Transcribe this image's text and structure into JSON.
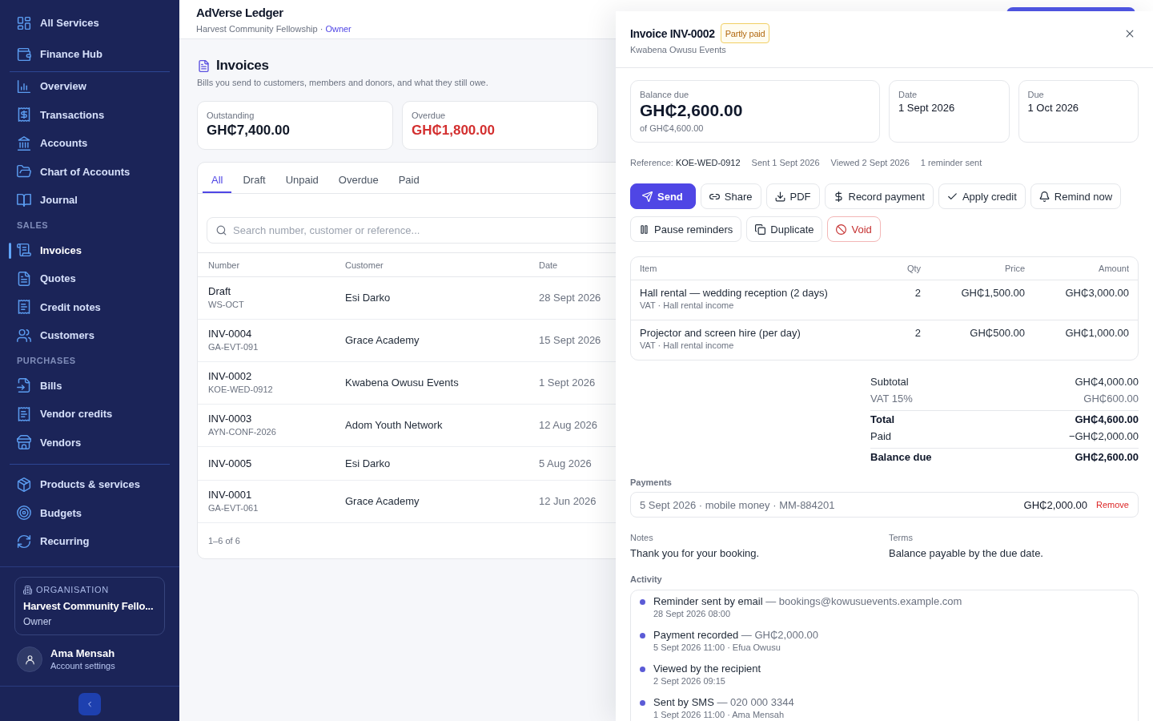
{
  "sidebar": {
    "groups": [
      {
        "items": [
          {
            "label": "All Services",
            "selected": false
          },
          {
            "label": "Finance Hub",
            "selected": false
          }
        ]
      },
      {
        "items": [
          {
            "label": "Overview",
            "selected": false
          },
          {
            "label": "Transactions",
            "selected": false
          },
          {
            "label": "Accounts",
            "selected": false
          },
          {
            "label": "Chart of Accounts",
            "selected": false
          },
          {
            "label": "Journal",
            "selected": false
          }
        ]
      },
      {
        "heading": "SALES",
        "items": [
          {
            "label": "Invoices",
            "selected": true
          },
          {
            "label": "Quotes",
            "selected": false
          },
          {
            "label": "Credit notes",
            "selected": false
          },
          {
            "label": "Customers",
            "selected": false
          }
        ]
      },
      {
        "heading": "PURCHASES",
        "items": [
          {
            "label": "Bills",
            "selected": false
          },
          {
            "label": "Vendor credits",
            "selected": false
          },
          {
            "label": "Vendors",
            "selected": false
          }
        ]
      },
      {
        "items": [
          {
            "label": "Products & services",
            "selected": false
          },
          {
            "label": "Budgets",
            "selected": false
          },
          {
            "label": "Recurring",
            "selected": false
          }
        ]
      }
    ],
    "organisation": {
      "label": "ORGANISATION",
      "name": "Harvest Community Fello...",
      "role": "Owner"
    },
    "user": {
      "name": "Ama Mensah",
      "link": "Account settings"
    }
  },
  "header": {
    "title": "AdVerse Ledger",
    "organisation": "Harvest Community Fellowship ·",
    "role": "Owner"
  },
  "page": {
    "title": "Invoices",
    "description": "Bills you send to customers, members and donors, and what they still owe."
  },
  "stats": [
    {
      "label": "Outstanding",
      "value": "GH₵7,400.00",
      "color": "#111827"
    },
    {
      "label": "Overdue",
      "value": "GH₵1,800.00",
      "color": "#d32f2f"
    }
  ],
  "tabs": [
    {
      "label": "All",
      "selected": true
    },
    {
      "label": "Draft",
      "selected": false
    },
    {
      "label": "Unpaid",
      "selected": false
    },
    {
      "label": "Overdue",
      "selected": false
    },
    {
      "label": "Paid",
      "selected": false
    }
  ],
  "search": {
    "placeholder": "Search number, customer or reference..."
  },
  "table": {
    "columns": [
      "Number",
      "Customer",
      "Date"
    ],
    "rows": [
      {
        "number": "Draft",
        "reference": "WS-OCT",
        "customer": "Esi Darko",
        "date": "28 Sept 2026"
      },
      {
        "number": "INV-0004",
        "reference": "GA-EVT-091",
        "customer": "Grace Academy",
        "date": "15 Sept 2026"
      },
      {
        "number": "INV-0002",
        "reference": "KOE-WED-0912",
        "customer": "Kwabena Owusu Events",
        "date": "1 Sept 2026"
      },
      {
        "number": "INV-0003",
        "reference": "AYN-CONF-2026",
        "customer": "Adom Youth Network",
        "date": "12 Aug 2026"
      },
      {
        "number": "INV-0005",
        "customer": "Esi Darko",
        "date": "5 Aug 2026"
      },
      {
        "number": "INV-0001",
        "reference": "GA-EVT-061",
        "customer": "Grace Academy",
        "date": "12 Jun 2026"
      }
    ],
    "footer": "1–6 of 6"
  },
  "drawer": {
    "title": "Invoice INV-0002",
    "status": "Partly paid",
    "customer": "Kwabena Owusu Events",
    "summary": [
      {
        "kind": "balance",
        "label": "Balance due",
        "value": "GH₵2,600.00",
        "note": "of GH₵4,600.00"
      },
      {
        "kind": "date",
        "label": "Date",
        "value": "1 Sept 2026"
      },
      {
        "kind": "date",
        "label": "Due",
        "value": "1 Oct 2026"
      }
    ],
    "reference": {
      "label": "Reference:",
      "value": "KOE-WED-0912"
    },
    "meta": [
      "Sent 1 Sept 2026",
      "Viewed 2 Sept 2026",
      "1 reminder sent"
    ],
    "actions": [
      {
        "label": "Send",
        "kind": "primary"
      },
      {
        "label": "Share",
        "kind": "default"
      },
      {
        "label": "PDF",
        "kind": "default"
      },
      {
        "label": "Record payment",
        "kind": "default"
      },
      {
        "label": "Apply credit",
        "kind": "default"
      },
      {
        "label": "Remind now",
        "kind": "default"
      },
      {
        "label": "Pause reminders",
        "kind": "default"
      },
      {
        "label": "Duplicate",
        "kind": "default"
      },
      {
        "label": "Void",
        "kind": "danger"
      }
    ],
    "line_items": {
      "columns": [
        "Item",
        "Qty",
        "Price",
        "Amount"
      ],
      "rows": [
        {
          "name": "Hall rental — wedding reception (2 days)",
          "detail": "VAT · Hall rental income",
          "qty": "2",
          "price": "GH₵1,500.00",
          "amount": "GH₵3,000.00"
        },
        {
          "name": "Projector and screen hire (per day)",
          "detail": "VAT · Hall rental income",
          "qty": "2",
          "price": "GH₵500.00",
          "amount": "GH₵1,000.00"
        }
      ]
    },
    "totals": [
      {
        "label": "Subtotal",
        "value": "GH₵4,000.00",
        "kind": "normal"
      },
      {
        "label": "VAT 15%",
        "value": "GH₵600.00",
        "kind": "muted"
      },
      {
        "label": "Total",
        "value": "GH₵4,600.00",
        "kind": "strong"
      },
      {
        "label": "Paid",
        "value": "−GH₵2,000.00",
        "kind": "normal"
      },
      {
        "label": "Balance due",
        "value": "GH₵2,600.00",
        "kind": "strong"
      }
    ],
    "payments": {
      "label": "Payments",
      "rows": [
        {
          "description": "5 Sept 2026 · mobile money · MM-884201",
          "amount": "GH₵2,000.00",
          "action": "Remove"
        }
      ]
    },
    "notes": {
      "label": "Notes",
      "text": "Thank you for your booking."
    },
    "terms": {
      "label": "Terms",
      "text": "Balance payable by the due date."
    },
    "activity": {
      "label": "Activity",
      "entries": [
        {
          "title": "Reminder sent by email",
          "detail": "— bookings@kowusuevents.example.com",
          "time": "28 Sept 2026 08:00"
        },
        {
          "title": "Payment recorded",
          "detail": "— GH₵2,000.00",
          "time": "5 Sept 2026 11:00 · Efua Owusu"
        },
        {
          "title": "Viewed by the recipient",
          "time": "2 Sept 2026 09:15"
        },
        {
          "title": "Sent by SMS",
          "detail": "— 020 000 3344",
          "time": "1 Sept 2026 11:00 · Ama Mensah"
        }
      ]
    }
  }
}
